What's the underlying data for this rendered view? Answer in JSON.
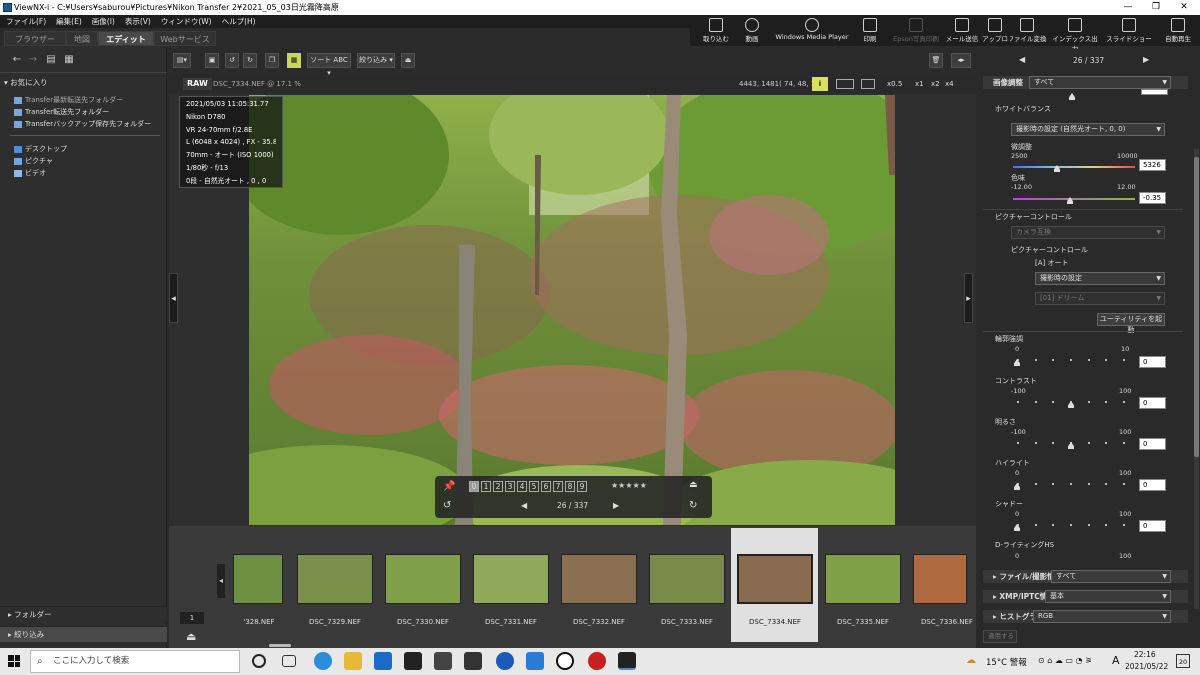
{
  "window": {
    "title": "ViewNX-i - C:¥Users¥saburou¥Pictures¥Nikon Transfer 2¥2021_05_03日光霧降高原",
    "controls": [
      "—",
      "❐",
      "✕"
    ]
  },
  "menu": [
    "ファイル(F)",
    "編集(E)",
    "画像(I)",
    "表示(V)",
    "ウィンドウ(W)",
    "ヘルプ(H)"
  ],
  "tabs": [
    {
      "label": "ブラウザー",
      "active": false
    },
    {
      "label": "地図",
      "active": false
    },
    {
      "label": "エディット",
      "active": true
    },
    {
      "label": "Webサービス",
      "active": false
    }
  ],
  "toolbar": [
    {
      "label": "取り込む",
      "icon": "import-icon",
      "enabled": true
    },
    {
      "label": "動画",
      "icon": "movie-icon",
      "enabled": true
    },
    {
      "label": "Windows Media Player",
      "icon": "wmp-icon",
      "enabled": true
    },
    {
      "label": "印刷",
      "icon": "print-icon",
      "enabled": true
    },
    {
      "label": "Epson写真印刷",
      "icon": "epson-print-icon",
      "enabled": false
    },
    {
      "label": "メール送信",
      "icon": "mail-icon",
      "enabled": true
    },
    {
      "label": "アップロード",
      "icon": "upload-icon",
      "enabled": true
    },
    {
      "label": "ファイル変換",
      "icon": "convert-icon",
      "enabled": true
    },
    {
      "label": "インデックス出力",
      "icon": "index-print-icon",
      "enabled": true
    },
    {
      "label": "スライドショー",
      "icon": "slideshow-icon",
      "enabled": true
    },
    {
      "label": "自動再生",
      "icon": "autoplay-icon",
      "enabled": true
    }
  ],
  "left_panel": {
    "favorites_header": "お気に入り",
    "favorites": [
      "Transfer最新転送先フォルダー",
      "Transfer転送先フォルダー",
      "Transferバックアップ保存先フォルダー"
    ],
    "places": [
      "デスクトップ",
      "ピクチャ",
      "ビデオ"
    ],
    "folder_header": "フォルダー",
    "filter_header": "絞り込み",
    "page_count": "1"
  },
  "viewer_toolbar": {
    "sort_label": "ソート ABC",
    "filter_label": "絞り込み"
  },
  "info_bar": {
    "raw_badge": "RAW",
    "filename": "DSC_7334.NEF @ 17.1 %",
    "pixel_info": "4443, 1481( 74, 48, 11)",
    "zoom_labels": [
      "x0.5",
      "x1",
      "x2",
      "x4"
    ]
  },
  "exif": [
    "2021/05/03 11:05:31.77",
    "Nikon D780",
    "VR 24-70mm f/2.8E",
    "L (6048 x 4024) , FX - 35.8 MB",
    "70mm - オート (ISO 1000)",
    "1/80秒 - f/13",
    "0段 - 自然光オート , 0 , 0"
  ],
  "overlay": {
    "labels": [
      "0",
      "1",
      "2",
      "3",
      "4",
      "5",
      "6",
      "7",
      "8",
      "9"
    ],
    "rating": "★★★★★",
    "counter": "26 / 337"
  },
  "filmstrip": {
    "items": [
      {
        "label": "'328.NEF",
        "selected": false
      },
      {
        "label": "DSC_7329.NEF",
        "selected": false
      },
      {
        "label": "DSC_7330.NEF",
        "selected": false
      },
      {
        "label": "DSC_7331.NEF",
        "selected": false
      },
      {
        "label": "DSC_7332.NEF",
        "selected": false
      },
      {
        "label": "DSC_7333.NEF",
        "selected": false
      },
      {
        "label": "DSC_7334.NEF",
        "selected": true
      },
      {
        "label": "DSC_7335.NEF",
        "selected": false
      },
      {
        "label": "DSC_7336.NEF",
        "selected": false
      }
    ]
  },
  "right_panel": {
    "nav_counter": "26 / 337",
    "adjust_header": "画像調整",
    "adjust_scope": "すべて",
    "wb_header": "ホワイトバランス",
    "wb_value": "撮影時の設定 (自然光オート, 0, 0)",
    "fine_tune_label": "微調整",
    "fine_min": "2500",
    "fine_max": "10000",
    "fine_value": "5326",
    "tint_label": "色味",
    "tint_min": "-12.00",
    "tint_max": "12.00",
    "tint_value": "-0.35",
    "pc_header": "ピクチャーコントロール",
    "pc_camera": "カメラ互換",
    "pc_label": "ピクチャーコントロール",
    "pc_mode": "[A] オート",
    "pc_setting": "撮影時の設定",
    "pc_dream": "[01] ドリーム",
    "utility_button": "ユーティリティを起動",
    "sliders": [
      {
        "label": "輪郭強調",
        "min": "0",
        "max": "10",
        "value": "0"
      },
      {
        "label": "コントラスト",
        "min": "-100",
        "max": "100",
        "value": "0"
      },
      {
        "label": "明るさ",
        "min": "-100",
        "max": "100",
        "value": "0"
      },
      {
        "label": "ハイライト",
        "min": "0",
        "max": "100",
        "value": "0"
      },
      {
        "label": "シャドー",
        "min": "0",
        "max": "100",
        "value": "0"
      }
    ],
    "dlighting_label": "D-ライティングHS",
    "dlighting_min": "0",
    "dlighting_max": "100",
    "file_info_header": "ファイル/撮影情報",
    "file_info_scope": "すべて",
    "xmp_header": "XMP/IPTC情報",
    "xmp_scope": "基本",
    "histogram_header": "ヒストグラム",
    "histogram_scope": "RGB",
    "apply_button": "適用する"
  },
  "taskbar": {
    "search_placeholder": "ここに入力して検索",
    "temp": "15°C 警報",
    "time": "22:16",
    "date": "2021/05/22",
    "ime": "A",
    "notifications": "20"
  }
}
